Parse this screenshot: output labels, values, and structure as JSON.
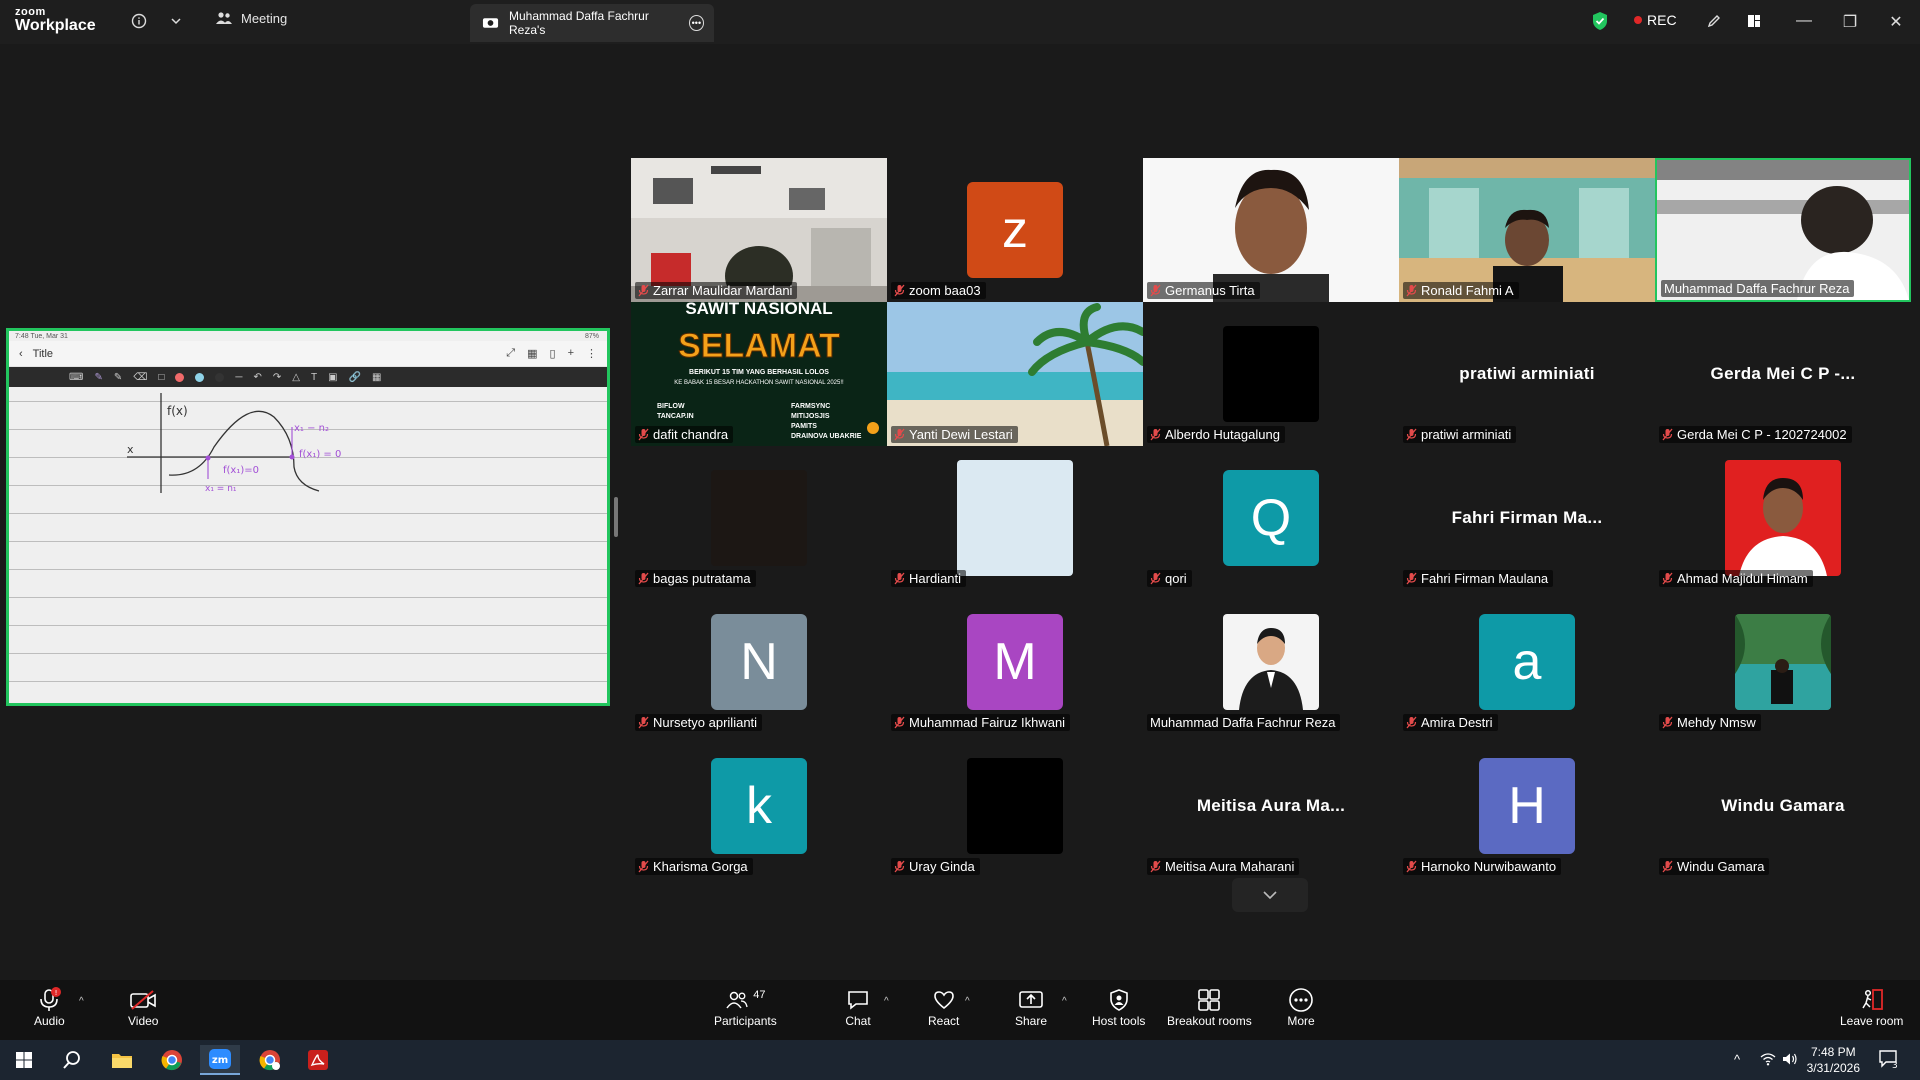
{
  "app": {
    "logo_line1": "zoom",
    "logo_line2": "Workplace"
  },
  "header": {
    "meeting_label": "Meeting",
    "share_tab_label": "Muhammad Daffa Fachrur Reza's",
    "rec_label": "REC"
  },
  "share": {
    "status_time": "7:48  Tue, Mar 31",
    "status_battery": "87%",
    "doc_title": "Title",
    "colors": [
      "#f06a6a",
      "#8fd3e8",
      "#333333"
    ],
    "sketch_labels": {
      "y_axis": "f(x)",
      "x_axis": "x",
      "x1_n2": "x₁ − n₂",
      "fx1_zero_right": "f(x₁) = 0",
      "fx1_zero_left": "f(x₁)=0",
      "x1_n1": "x₁ = n₁"
    }
  },
  "participants": [
    {
      "name": "Zarrar Maulidar Mardani",
      "type": "video",
      "muted": true
    },
    {
      "name": "zoom baa03",
      "type": "avatar",
      "letter": "z",
      "color": "#d04a16",
      "muted": true
    },
    {
      "name": "Germanus Tirta",
      "type": "video",
      "muted": true
    },
    {
      "name": "Ronald Fahmi A",
      "type": "video",
      "muted": true
    },
    {
      "name": "Muhammad Daffa Fachrur Reza",
      "type": "video",
      "muted": false,
      "speaking": true
    },
    {
      "name": "dafit chandra",
      "type": "video",
      "muted": true
    },
    {
      "name": "Yanti Dewi Lestari",
      "type": "video",
      "muted": true
    },
    {
      "name": "Alberdo Hutagalung",
      "type": "photo",
      "muted": true
    },
    {
      "name": "pratiwi arminiati",
      "type": "name",
      "display": "pratiwi arminiati",
      "muted": true
    },
    {
      "name": "Gerda Mei C P - 1202724002",
      "type": "name",
      "display": "Gerda Mei C P -...",
      "muted": true
    },
    {
      "name": "bagas putratama",
      "type": "photo",
      "muted": true
    },
    {
      "name": "Hardianti",
      "type": "photo",
      "muted": true
    },
    {
      "name": "qori",
      "type": "avatar",
      "letter": "Q",
      "color": "#0e9aa7",
      "muted": true
    },
    {
      "name": "Fahri Firman Maulana",
      "type": "name",
      "display": "Fahri Firman Ma...",
      "muted": true
    },
    {
      "name": "Ahmad Majidul Himam",
      "type": "photo",
      "muted": true
    },
    {
      "name": "Nursetyo aprilianti",
      "type": "avatar",
      "letter": "N",
      "color": "#7a8d9a",
      "muted": true
    },
    {
      "name": "Muhammad Fairuz Ikhwani",
      "type": "avatar",
      "letter": "M",
      "color": "#a946c2",
      "muted": true
    },
    {
      "name": "Muhammad Daffa Fachrur Reza",
      "type": "photo",
      "muted": false
    },
    {
      "name": "Amira Destri",
      "type": "avatar",
      "letter": "a",
      "color": "#0e9aa7",
      "muted": true
    },
    {
      "name": "Mehdy Nmsw",
      "type": "photo",
      "muted": true
    },
    {
      "name": "Kharisma Gorga",
      "type": "avatar",
      "letter": "k",
      "color": "#0e9aa7",
      "muted": true
    },
    {
      "name": "Uray Ginda",
      "type": "photo",
      "muted": true
    },
    {
      "name": "Meitisa Aura Maharani",
      "type": "name",
      "display": "Meitisa Aura Ma...",
      "muted": true
    },
    {
      "name": "Harnoko Nurwibawanto",
      "type": "avatar",
      "letter": "H",
      "color": "#5b6ac2",
      "muted": true
    },
    {
      "name": "Windu Gamara",
      "type": "name",
      "display": "Windu Gamara",
      "muted": true
    }
  ],
  "banner": {
    "title": "SAWIT NASIONAL",
    "headline": "SELAMAT",
    "subline": "BERIKUT 15 TIM YANG BERHASIL LOLOS",
    "subline2": "KE BABAK 15 BESAR HACKATHON SAWIT NASIONAL 2025!!",
    "teams_left": [
      "BIFLOW",
      "TANCAP.IN"
    ],
    "teams_right": [
      "FARMSYNC",
      "MITIJOSJIS",
      "PAMITS",
      "DRAINOVA UBAKRIE"
    ]
  },
  "toolbar": {
    "audio": "Audio",
    "video": "Video",
    "participants": "Participants",
    "participants_count": "47",
    "chat": "Chat",
    "react": "React",
    "share": "Share",
    "host_tools": "Host tools",
    "breakout": "Breakout rooms",
    "more": "More",
    "leave": "Leave room"
  },
  "taskbar": {
    "time": "7:48 PM",
    "date": "3/31/2026",
    "notifications": "3"
  }
}
